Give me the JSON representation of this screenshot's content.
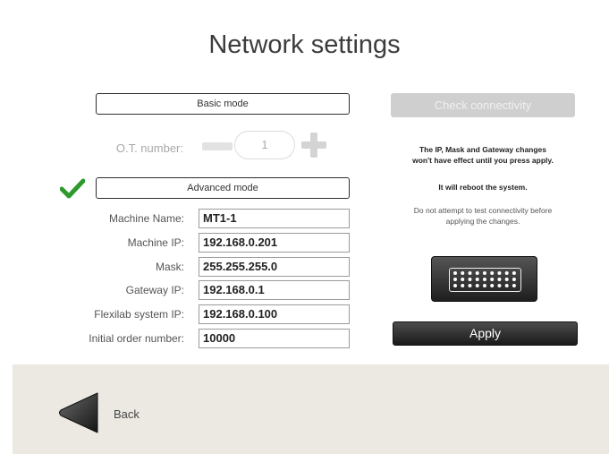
{
  "page": {
    "title": "Network settings"
  },
  "modes": {
    "basic_label": "Basic mode",
    "advanced_label": "Advanced mode",
    "selected": "advanced"
  },
  "ot": {
    "label": "O.T. number:",
    "value": "1"
  },
  "fields": [
    {
      "label": "Machine Name:",
      "value": "MT1-1"
    },
    {
      "label": "Machine IP:",
      "value": "192.168.0.201"
    },
    {
      "label": "Mask:",
      "value": "255.255.255.0"
    },
    {
      "label": "Gateway IP:",
      "value": "192.168.0.1"
    },
    {
      "label": "Flexilab system IP:",
      "value": "192.168.0.100"
    },
    {
      "label": "Initial order number:",
      "value": "10000"
    }
  ],
  "right_panel": {
    "check_connectivity_label": "Check connectivity",
    "info_line1": "The IP, Mask and Gateway changes",
    "info_line2": "won't have effect until you press apply.",
    "reboot_note": "It will reboot the system.",
    "warn_line1": "Do not attempt to test connectivity before",
    "warn_line2": "applying the changes.",
    "apply_label": "Apply"
  },
  "footer": {
    "back_label": "Back"
  },
  "colors": {
    "check": "#2e9a2e",
    "footer_bg": "#ebe9e2",
    "disabled": "#cfcfcf"
  },
  "icons": {
    "check": "checkmark-icon",
    "plus": "plus-icon",
    "minus": "minus-icon",
    "keyboard": "keyboard-icon",
    "back": "back-arrow-icon"
  }
}
